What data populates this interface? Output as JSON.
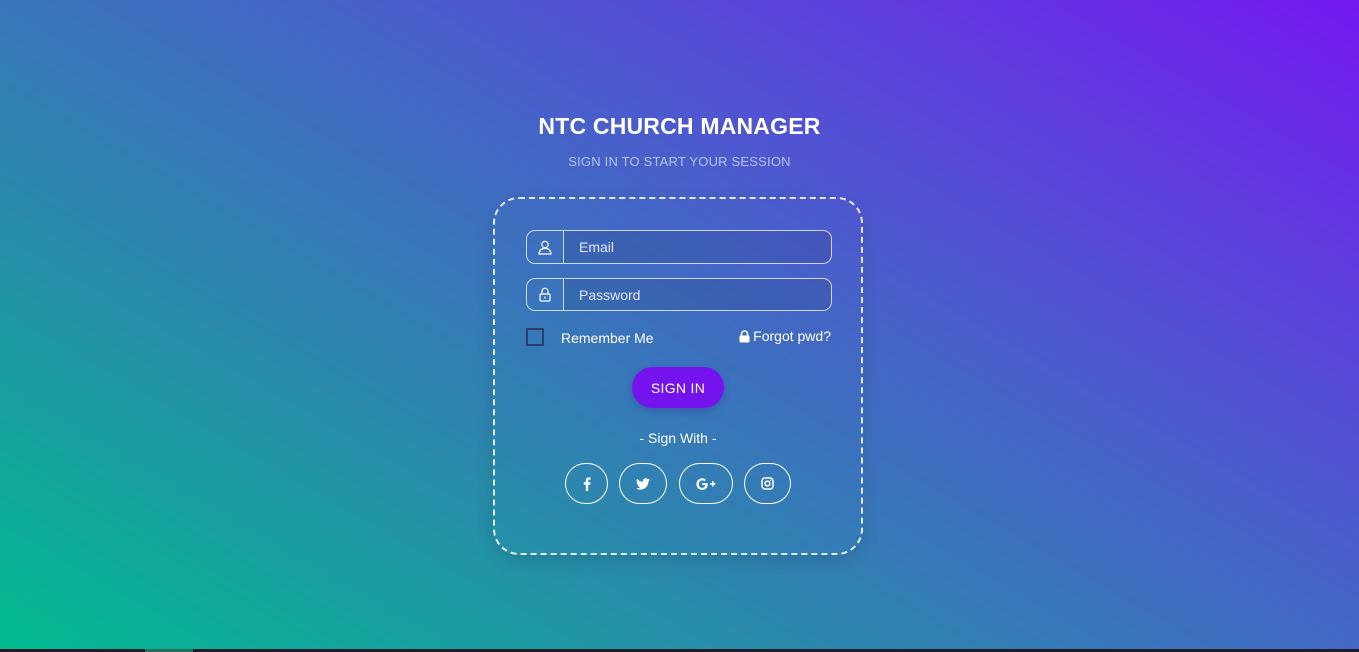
{
  "header": {
    "title": "NTC CHURCH MANAGER",
    "subtitle": "SIGN IN TO START YOUR SESSION"
  },
  "form": {
    "email_placeholder": "Email",
    "password_placeholder": "Password",
    "remember_label": "Remember Me",
    "remember_checked": false,
    "forgot_label": "Forgot pwd?",
    "signin_label": "SIGN IN",
    "sign_with_label": "- Sign With -"
  },
  "social": [
    {
      "name": "facebook",
      "icon": "facebook-icon"
    },
    {
      "name": "twitter",
      "icon": "twitter-icon"
    },
    {
      "name": "google-plus",
      "icon": "google-plus-icon"
    },
    {
      "name": "instagram",
      "icon": "instagram-icon"
    }
  ],
  "colors": {
    "accent": "#7513ee",
    "gradient_start": "#00bb8f",
    "gradient_end": "#7519f1"
  }
}
